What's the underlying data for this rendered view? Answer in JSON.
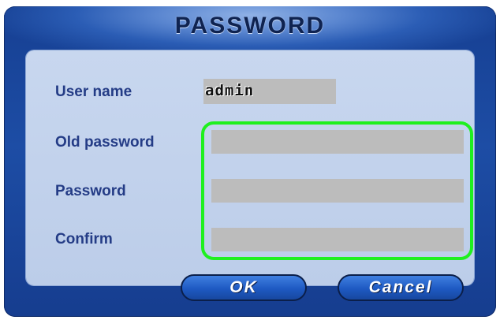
{
  "dialog": {
    "title": "PASSWORD"
  },
  "fields": {
    "user_name_label": "User name",
    "user_name_value": "admin",
    "old_password_label": "Old password",
    "old_password_value": "",
    "password_label": "Password",
    "password_value": "",
    "confirm_label": "Confirm",
    "confirm_value": ""
  },
  "buttons": {
    "ok": "OK",
    "cancel": "Cancel"
  },
  "colors": {
    "dialog_blue": "#1d4da5",
    "panel_light_blue": "#c8d7ef",
    "label_blue": "#243c86",
    "field_gray": "#bcbcbc",
    "highlight_green": "#1ff01f"
  }
}
